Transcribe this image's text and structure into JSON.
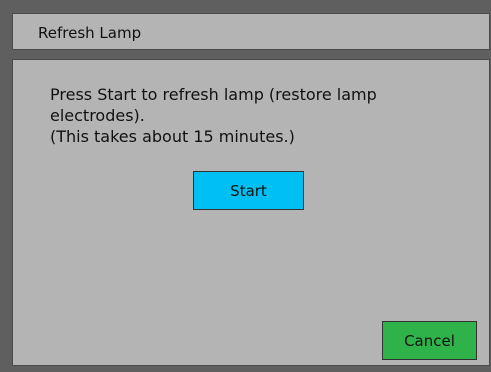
{
  "dialog": {
    "title": "Refresh Lamp",
    "message_lines": [
      "Press Start to refresh lamp (restore lamp",
      "electrodes).",
      "(This takes about 15 minutes.)"
    ],
    "start_label": "Start",
    "cancel_label": "Cancel"
  },
  "colors": {
    "background": "#5f5f5f",
    "panel": "#b4b4b4",
    "start_button": "#00bff2",
    "cancel_button": "#2fb24a"
  }
}
